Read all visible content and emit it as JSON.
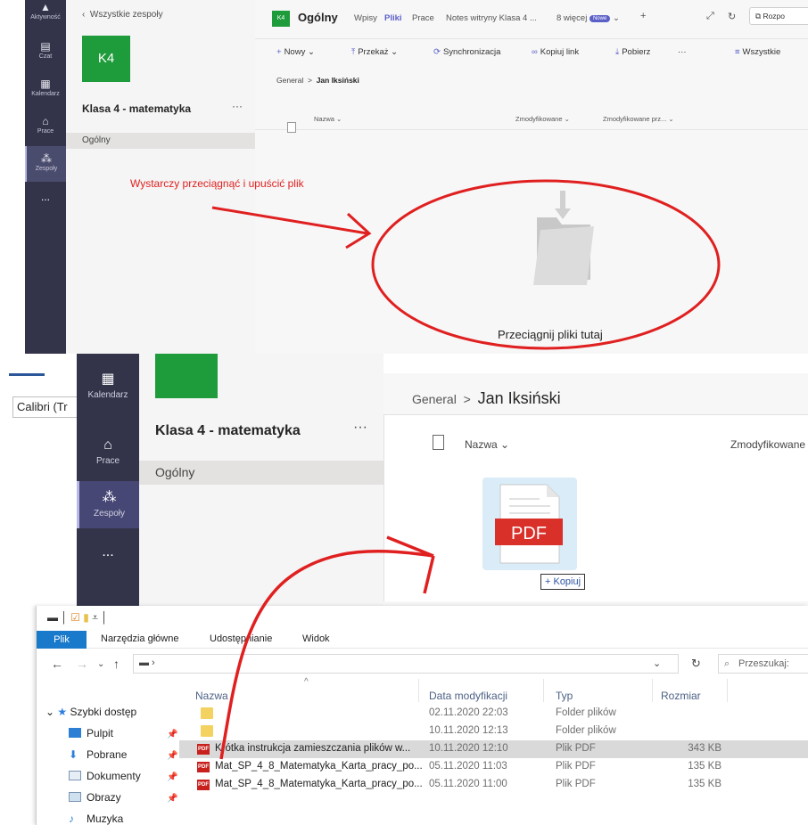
{
  "top": {
    "rail": {
      "items": [
        {
          "label": "Aktywność",
          "icon": "bell-icon"
        },
        {
          "label": "Czat",
          "icon": "chat-icon"
        },
        {
          "label": "Kalendarz",
          "icon": "calendar-icon"
        },
        {
          "label": "Prace",
          "icon": "backpack-icon"
        },
        {
          "label": "Zespoły",
          "icon": "teams-icon"
        },
        {
          "label": "...",
          "icon": "more-icon"
        }
      ]
    },
    "left": {
      "back_label": "Wszystkie zespoły",
      "tile": "K4",
      "team_name": "Klasa 4 - matematyka",
      "more": "···",
      "channel": "Ogólny"
    },
    "header": {
      "tile": "K4",
      "title": "Ogólny",
      "tabs": [
        "Wpisy",
        "Pliki",
        "Prace",
        "Notes witryny Klasa 4 ...",
        "8 więcej"
      ],
      "new_badge": "Nowe",
      "plus": "+",
      "rozpo_label": "Rozpo"
    },
    "commands": [
      "Nowy",
      "Przekaż",
      "Synchronizacja",
      "Kopiuj link",
      "Pobierz",
      "···",
      "Wszystkie"
    ],
    "breadcrumb": {
      "parent": "General",
      "current": "Jan Iksiński"
    },
    "columns": [
      "Nazwa",
      "Zmodyfikowane",
      "Zmodyfikowane prz..."
    ],
    "drop_text": "Przeciągnij pliki tutaj",
    "annotation": "Wystarczy przeciągnąć i upuścić plik"
  },
  "bottom": {
    "font_box": "Calibri (Tr",
    "rail": {
      "items": [
        {
          "label": "Kalendarz",
          "icon": "calendar-icon"
        },
        {
          "label": "Prace",
          "icon": "backpack-icon"
        },
        {
          "label": "Zespoły",
          "icon": "teams-icon"
        },
        {
          "label": "...",
          "icon": "more-icon"
        }
      ]
    },
    "left": {
      "team_name": "Klasa 4 - matematyka",
      "more": "···",
      "channel": "Ogólny"
    },
    "breadcrumb": {
      "parent": "General",
      "current": "Jan Iksiński"
    },
    "columns": [
      "Nazwa",
      "Zmodyfikowane"
    ],
    "pdf_label": "PDF",
    "copy_label": "+ Kopiuj",
    "explorer": {
      "ribbon_tabs": [
        "Plik",
        "Narzędzia główne",
        "Udostępnianie",
        "Widok"
      ],
      "search_placeholder": "Przeszukaj:",
      "nav_pane": [
        {
          "label": "Szybki dostęp",
          "icon": "star-icon",
          "pinned": false
        },
        {
          "label": "Pulpit",
          "icon": "desktop-icon",
          "pinned": true
        },
        {
          "label": "Pobrane",
          "icon": "download-icon",
          "pinned": true
        },
        {
          "label": "Dokumenty",
          "icon": "documents-icon",
          "pinned": true
        },
        {
          "label": "Obrazy",
          "icon": "pictures-icon",
          "pinned": true
        },
        {
          "label": "Muzyka",
          "icon": "music-icon",
          "pinned": false
        }
      ],
      "columns": [
        "Nazwa",
        "Data modyfikacji",
        "Typ",
        "Rozmiar"
      ],
      "rows": [
        {
          "name": "",
          "date": "02.11.2020 22:03",
          "type": "Folder plików",
          "size": "",
          "kind": "folder",
          "selected": false
        },
        {
          "name": "",
          "date": "10.11.2020 12:13",
          "type": "Folder plików",
          "size": "",
          "kind": "folder",
          "selected": false
        },
        {
          "name": "Krótka instrukcja zamieszczania plików w...",
          "date": "10.11.2020 12:10",
          "type": "Plik PDF",
          "size": "343 KB",
          "kind": "pdf",
          "selected": true
        },
        {
          "name": "Mat_SP_4_8_Matematyka_Karta_pracy_po...",
          "date": "05.11.2020 11:03",
          "type": "Plik PDF",
          "size": "135 KB",
          "kind": "pdf",
          "selected": false
        },
        {
          "name": "Mat_SP_4_8_Matematyka_Karta_pracy_po...",
          "date": "05.11.2020 11:00",
          "type": "Plik PDF",
          "size": "135 KB",
          "kind": "pdf",
          "selected": false
        }
      ]
    }
  },
  "colors": {
    "teams_rail": "#33344a",
    "teams_accent": "#5b5fc7",
    "team_green": "#1e9b3a",
    "annotation_red": "#e02020",
    "explorer_blue": "#1979ca",
    "pdf_red": "#c8201c"
  }
}
